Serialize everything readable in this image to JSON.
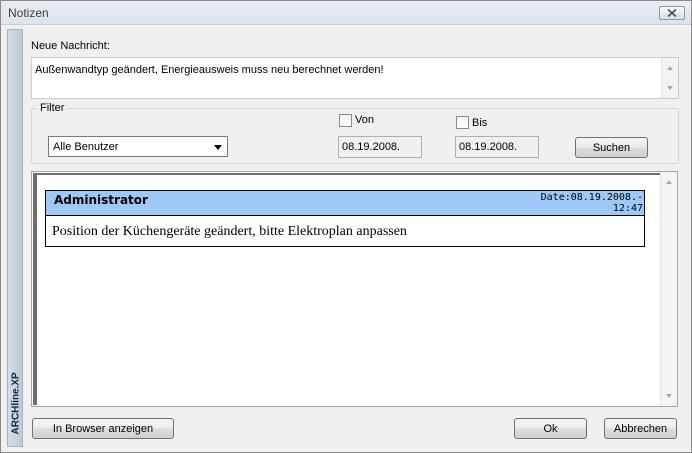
{
  "window": {
    "title": "Notizen"
  },
  "sidebar": {
    "brand": "ARCHline.XP"
  },
  "message": {
    "label": "Neue Nachricht:",
    "value": "Außenwandtyp geändert, Energieausweis muss neu berechnet werden!"
  },
  "filter": {
    "legend": "Filter",
    "user_select": {
      "selected": "Alle Benutzer"
    },
    "from": {
      "label": "Von",
      "checked": false,
      "date": "08.19.2008."
    },
    "to": {
      "label": "Bis",
      "checked": false,
      "date": "08.19.2008."
    },
    "search_label": "Suchen"
  },
  "notes": [
    {
      "author": "Administrator",
      "date_line1": "Date:08.19.2008.-",
      "date_line2": "12:47",
      "text": "Position der Küchengeräte geändert, bitte Elektroplan anpassen"
    }
  ],
  "footer": {
    "browser_label": "In Browser anzeigen",
    "ok_label": "Ok",
    "cancel_label": "Abbrechen"
  },
  "colors": {
    "note_header": "#9ec8f6",
    "window_bg": "#f0f0f0"
  },
  "icons": {
    "close": "close-icon",
    "dropdown": "chevron-down-icon"
  }
}
